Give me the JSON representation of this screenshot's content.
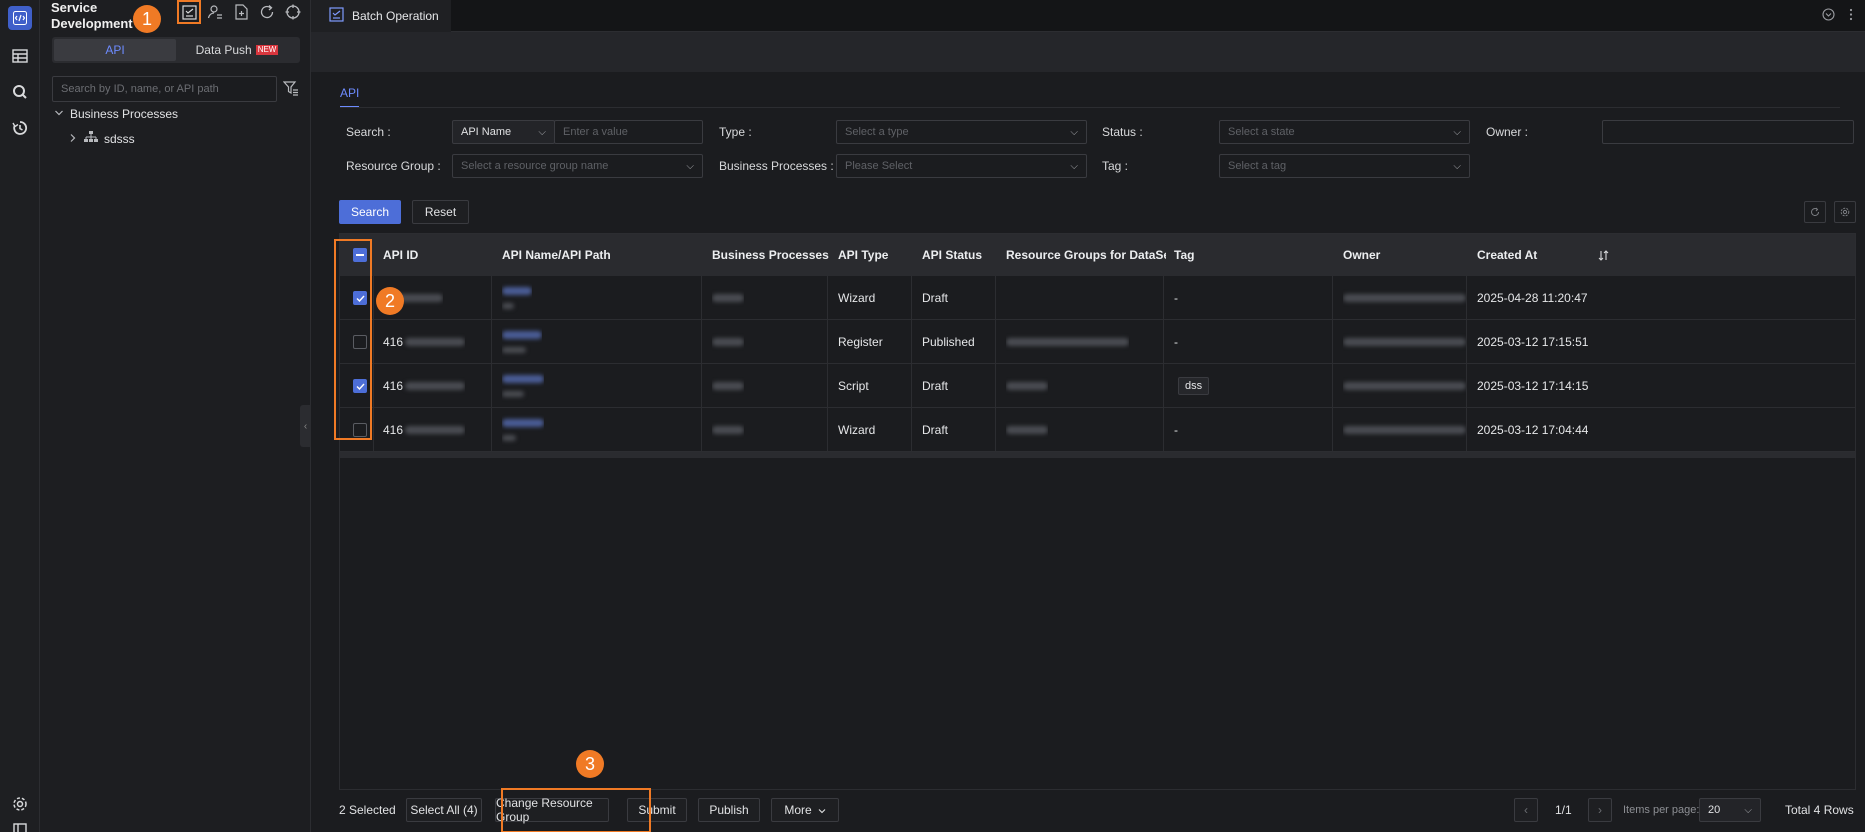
{
  "sidebar": {
    "title": "Service Development",
    "segments": [
      {
        "label": "API",
        "active": true
      },
      {
        "label": "Data Push",
        "badge": "NEW",
        "active": false
      }
    ],
    "search_placeholder": "Search by ID, name, or API path",
    "tree": [
      {
        "label": "Business Processes",
        "expanded": true
      },
      {
        "label": "sdsss",
        "expanded": false
      }
    ]
  },
  "tabs": [
    {
      "label": "Batch Operation",
      "active": true
    }
  ],
  "content_tab": "API",
  "filters": {
    "search_label": "Search :",
    "search_field": "API Name",
    "search_placeholder": "Enter a value",
    "type_label": "Type :",
    "type_placeholder": "Select a type",
    "status_label": "Status :",
    "status_placeholder": "Select a state",
    "owner_label": "Owner :",
    "owner_value": "",
    "resource_group_label": "Resource Group :",
    "resource_group_placeholder": "Select a resource group name",
    "business_processes_label": "Business Processes :",
    "business_processes_placeholder": "Please Select",
    "tag_label": "Tag :",
    "tag_placeholder": "Select a tag"
  },
  "buttons": {
    "search": "Search",
    "reset": "Reset"
  },
  "table": {
    "columns": [
      "API ID",
      "API Name/API Path",
      "Business Processes",
      "API Type",
      "API Status",
      "Resource Groups for DataServi...",
      "Tag",
      "Owner",
      "Created At"
    ],
    "rows": [
      {
        "checked": true,
        "api_id": "",
        "api_type": "Wizard",
        "api_status": "Draft",
        "tag": "-",
        "created_at": "2025-04-28 11:20:47"
      },
      {
        "checked": false,
        "api_id": "416",
        "api_type": "Register",
        "api_status": "Published",
        "tag": "-",
        "created_at": "2025-03-12 17:15:51"
      },
      {
        "checked": true,
        "api_id": "416",
        "api_type": "Script",
        "api_status": "Draft",
        "tag": "dss",
        "created_at": "2025-03-12 17:14:15"
      },
      {
        "checked": false,
        "api_id": "416",
        "api_type": "Wizard",
        "api_status": "Draft",
        "tag": "-",
        "created_at": "2025-03-12 17:04:44"
      }
    ]
  },
  "footer": {
    "selected": "2 Selected",
    "select_all": "Select All (4)",
    "change_resource_group": "Change Resource Group",
    "submit": "Submit",
    "publish": "Publish",
    "more": "More",
    "page": "1/1",
    "items_per_page_label": "Items per page:",
    "items_per_page": "20",
    "total": "Total 4 Rows"
  },
  "callouts": [
    "1",
    "2",
    "3"
  ],
  "colors": {
    "accent": "#4d6ed8",
    "highlight": "#f07a25"
  }
}
